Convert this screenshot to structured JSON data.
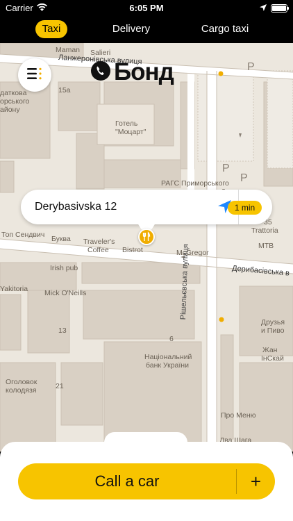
{
  "status_bar": {
    "carrier": "Carrier",
    "time": "6:05 PM",
    "battery_level": 1.0
  },
  "tabs": [
    {
      "label": "Taxi",
      "active": true
    },
    {
      "label": "Delivery",
      "active": false
    },
    {
      "label": "Cargo taxi",
      "active": false
    }
  ],
  "brand": {
    "name": "Бонд"
  },
  "address": {
    "text": "Derybasivska 12",
    "eta": "1 min"
  },
  "map_labels": {
    "street_top": "Ланжеронівська вулиця",
    "saliery": "Salieri",
    "maman": "Maman",
    "num_15a": "15а",
    "adm1": "датковa",
    "adm2": "орського",
    "adm3": "айону",
    "hotel1": "Готель",
    "hotel2": "\"Моцарт\"",
    "rags": "РАГС Приморського",
    "top_sendvich": "Топ Сендвич",
    "bukva": "Буква",
    "travelers1": "Traveler's",
    "travelers2": "Coffee",
    "bistrot": "Bistrot",
    "mcgregor": "McGregor",
    "num_35": "35",
    "trattoria": "Trattoria",
    "mtb": "МТВ",
    "derybas_street": "Дерибасівська в",
    "irish_pub": "Irish pub",
    "yakitoria": "Yakitoria",
    "mick": "Mick O'Neills",
    "num_13": "13",
    "rishelievska": "Рішельєвська вулиця",
    "druzi1": "Друзья",
    "druzi2": "и Пиво",
    "zhan1": "Жан",
    "zhan2": "ІнСкай",
    "num_6": "6",
    "bank1": "Національний",
    "bank2": "банк України",
    "num_21": "21",
    "ogolovok1": "Оголовок",
    "ogolovok2": "колодязя",
    "pro_menu": "Про Меню",
    "dva_shaga": "Два Шага",
    "parking": "P"
  },
  "actions": {
    "call_label": "Call a car",
    "add_label": "+"
  },
  "colors": {
    "accent": "#f7c400",
    "map_bg": "#ece7de",
    "building": "#d9d0c4",
    "road": "#ffffff"
  },
  "icons": [
    "wifi-icon",
    "location-arrow-icon",
    "battery-icon",
    "menu-icon",
    "phone-icon",
    "navigation-arrow-icon",
    "restaurant-pin-icon"
  ]
}
